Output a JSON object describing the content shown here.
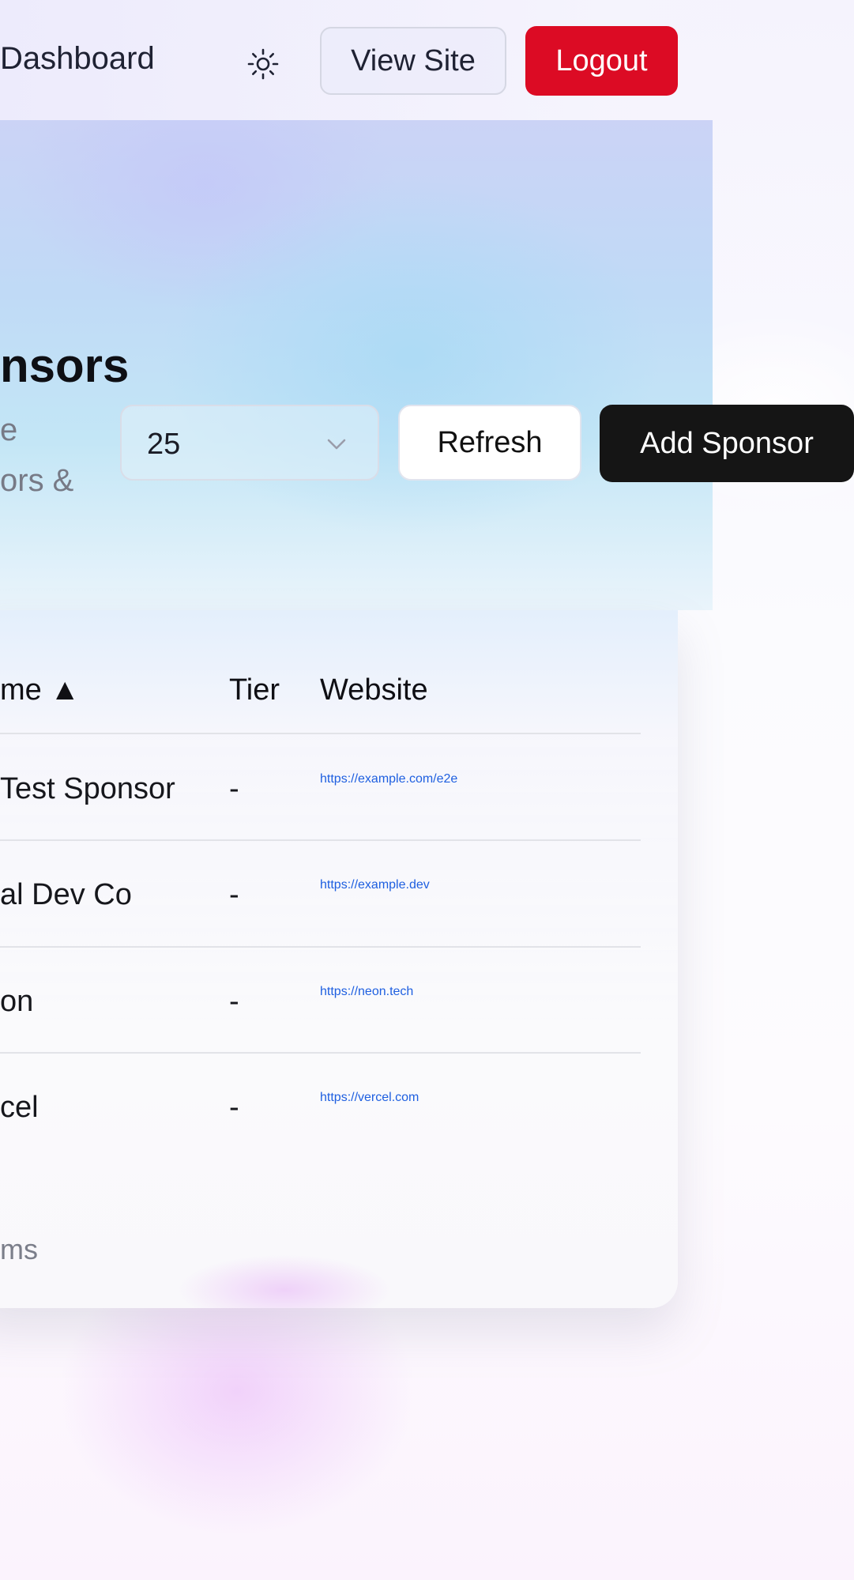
{
  "header": {
    "brand_text": "Dashboard",
    "theme_toggle_icon": "sun-icon",
    "view_site_label": "View Site",
    "logout_label": "Logout",
    "logout_color": "#dc0b24"
  },
  "page": {
    "title": "nsors",
    "description": "e\nors &"
  },
  "controls": {
    "page_size_value": "25",
    "refresh_label": "Refresh",
    "add_label": "Add Sponsor"
  },
  "table": {
    "columns": [
      "me ▲",
      "Tier",
      "Website"
    ],
    "rows": [
      {
        "name": " Test Sponsor",
        "tier": "-",
        "website": "https://example.com/e2e"
      },
      {
        "name": "al Dev Co",
        "tier": "-",
        "website": "https://example.dev"
      },
      {
        "name": "on",
        "tier": "-",
        "website": "https://neon.tech"
      },
      {
        "name": "cel",
        "tier": "-",
        "website": "https://vercel.com"
      }
    ],
    "footer_text": "ms"
  },
  "colors": {
    "link": "#1e5fe0",
    "primary_button": "#151515"
  }
}
